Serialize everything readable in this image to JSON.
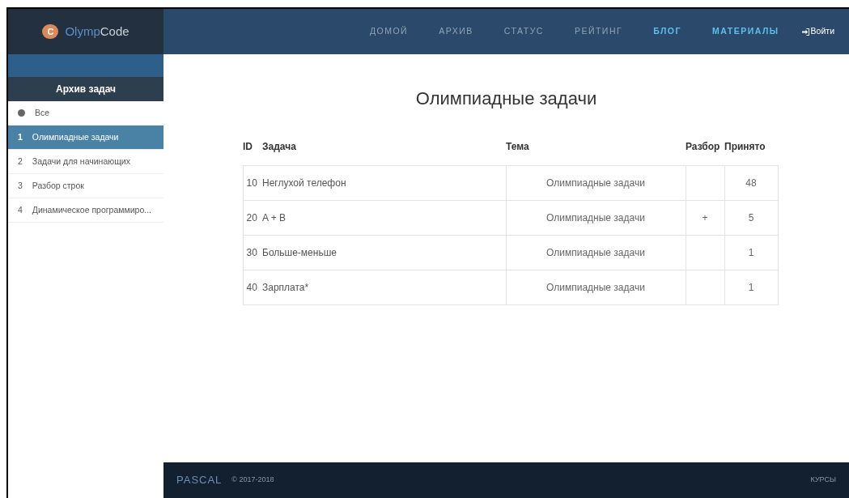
{
  "logo": {
    "mark": "C",
    "name_a": "Olymp",
    "name_b": "Code"
  },
  "nav": [
    {
      "label": "ДОМОЙ",
      "accent": false
    },
    {
      "label": "АРХИВ",
      "accent": false
    },
    {
      "label": "СТАТУС",
      "accent": false
    },
    {
      "label": "РЕЙТИНГ",
      "accent": false
    },
    {
      "label": "БЛОГ",
      "accent": true
    },
    {
      "label": "МАТЕРИАЛЫ",
      "accent": true
    }
  ],
  "login": "Войти",
  "sidebar": {
    "title": "Архив задач",
    "items": [
      {
        "marker": "",
        "label": "Все",
        "kind": "info",
        "selected": false
      },
      {
        "marker": "1",
        "label": "Олимпиадные задачи",
        "kind": "numbered",
        "selected": true
      },
      {
        "marker": "2",
        "label": "Задачи для начинающих",
        "kind": "numbered",
        "selected": false
      },
      {
        "marker": "3",
        "label": "Разбор строк",
        "kind": "numbered",
        "selected": false
      },
      {
        "marker": "4",
        "label": "Динамическое программиро...",
        "kind": "numbered",
        "selected": false
      }
    ]
  },
  "page_title": "Олимпиадные задачи",
  "table": {
    "columns": [
      "ID",
      "Задача",
      "Тема",
      "Разбор",
      "Принято"
    ],
    "rows": [
      {
        "id": "10",
        "task": "Неглухой телефон",
        "topic": "Олимпиадные задачи",
        "review": "",
        "accepted": "48"
      },
      {
        "id": "20",
        "task": "A + B",
        "topic": "Олимпиадные задачи",
        "review": "+",
        "accepted": "5"
      },
      {
        "id": "30",
        "task": "Больше-меньше",
        "topic": "Олимпиадные задачи",
        "review": "",
        "accepted": "1"
      },
      {
        "id": "40",
        "task": "Зарплата*",
        "topic": "Олимпиадные задачи",
        "review": "",
        "accepted": "1"
      }
    ]
  },
  "footer": {
    "brand": "PASCAL",
    "copyright": "© 2017-2018",
    "link": "КУРСЫ"
  }
}
